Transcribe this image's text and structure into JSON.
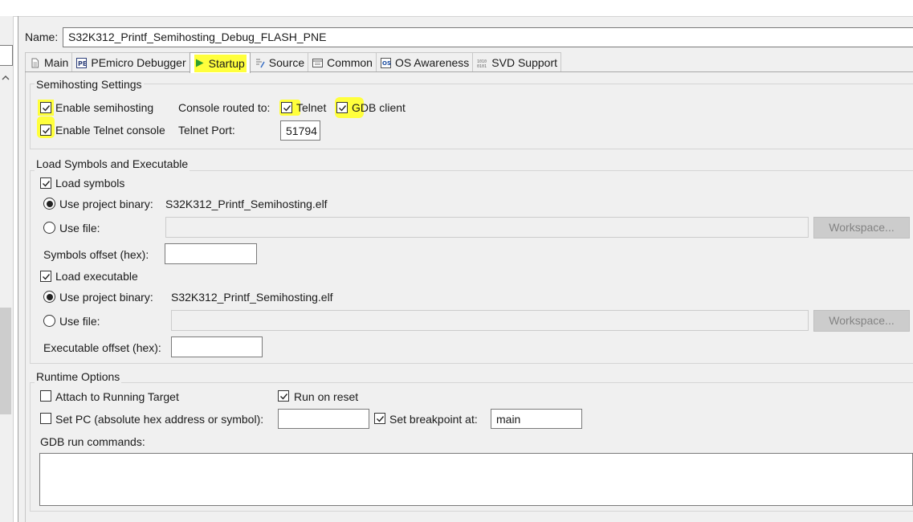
{
  "config": {
    "name_label": "Name:",
    "name_value": "S32K312_Printf_Semihosting_Debug_FLASH_PNE"
  },
  "tabs": [
    {
      "label": "Main",
      "icon": "document-icon"
    },
    {
      "label": "PEmicro Debugger",
      "icon": "pemicro-icon"
    },
    {
      "label": "Startup",
      "icon": "play-icon",
      "active": true
    },
    {
      "label": "Source",
      "icon": "source-icon"
    },
    {
      "label": "Common",
      "icon": "common-icon"
    },
    {
      "label": "OS Awareness",
      "icon": "os-icon"
    },
    {
      "label": "SVD Support",
      "icon": "binary-icon"
    }
  ],
  "semihosting": {
    "title": "Semihosting Settings",
    "enable_label": "Enable semihosting",
    "enable_checked": true,
    "console_routed_label": "Console routed to:",
    "telnet_label": "Telnet",
    "telnet_checked": true,
    "gdb_client_label": "GDB client",
    "gdb_client_checked": true,
    "enable_telnet_label": "Enable Telnet console",
    "enable_telnet_checked": true,
    "telnet_port_label": "Telnet Port:",
    "telnet_port_value": "51794"
  },
  "load": {
    "title": "Load Symbols and Executable",
    "load_symbols_label": "Load symbols",
    "load_symbols_checked": true,
    "sym_use_project_label": "Use project binary:",
    "sym_project_binary": "S32K312_Printf_Semihosting.elf",
    "sym_use_file_label": "Use file:",
    "sym_workspace_btn": "Workspace...",
    "sym_offset_label": "Symbols offset (hex):",
    "sym_offset_value": "",
    "load_exec_label": "Load executable",
    "load_exec_checked": true,
    "exe_use_project_label": "Use project binary:",
    "exe_project_binary": "S32K312_Printf_Semihosting.elf",
    "exe_use_file_label": "Use file:",
    "exe_workspace_btn": "Workspace...",
    "exe_offset_label": "Executable offset (hex):",
    "exe_offset_value": ""
  },
  "runtime": {
    "title": "Runtime Options",
    "attach_label": "Attach to Running Target",
    "attach_checked": false,
    "run_on_reset_label": "Run on reset",
    "run_on_reset_checked": true,
    "set_pc_label": "Set PC (absolute hex address or symbol):",
    "set_pc_checked": false,
    "set_pc_value": "",
    "set_bp_label": "Set breakpoint at:",
    "set_bp_checked": true,
    "set_bp_value": "main",
    "gdb_run_label": "GDB run commands:",
    "gdb_run_value": ""
  },
  "colors": {
    "highlight": "#ffff3c",
    "panel_bg": "#f0f0f0",
    "disabled_button_bg": "#cccccc",
    "startup_icon": "#2e9e2e"
  }
}
